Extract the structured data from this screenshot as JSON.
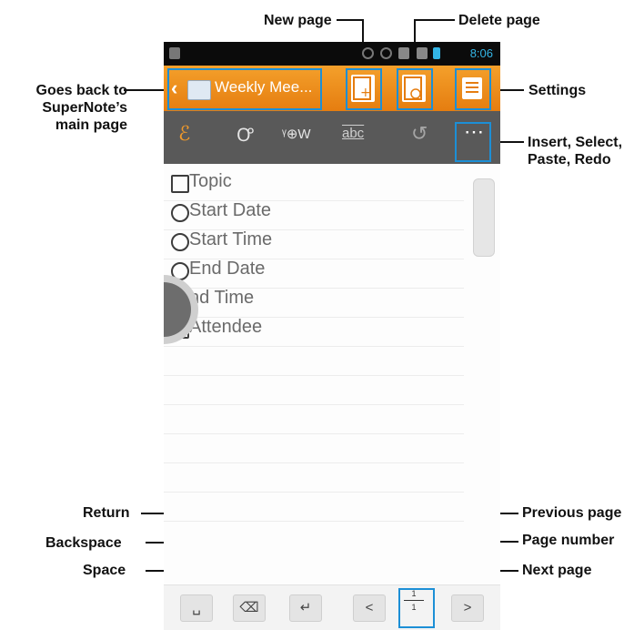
{
  "status_bar": {
    "time": "8:06"
  },
  "app_bar": {
    "back_glyph": "‹",
    "title": "Weekly Mee...",
    "notebook_icon": "notebook-icon"
  },
  "toolbar": {
    "pen_glyph": "ℰ",
    "handwrite_glyph": "Ꝍ",
    "hw_label": "ᵞ⊕W",
    "abc_label": "abc",
    "undo_glyph": "↺",
    "more_glyph": "⋯"
  },
  "template": {
    "items": [
      {
        "label": "Topic",
        "icon": "topic-icon"
      },
      {
        "label": "Start Date",
        "icon": "clock-icon"
      },
      {
        "label": "Start Time",
        "icon": "clock-icon"
      },
      {
        "label": "End Date",
        "icon": "clock-icon"
      },
      {
        "label": "nd Time",
        "icon": "clock-icon"
      },
      {
        "label": "Attendee",
        "icon": "person-icon"
      }
    ]
  },
  "keys": {
    "space": "␣",
    "backspace": "⌫",
    "return": "↵",
    "prev": "<",
    "next": ">",
    "page_top": "1",
    "page_bottom": "1"
  },
  "callouts": {
    "new_page": "New page",
    "delete_page": "Delete page",
    "goes_back_1": "Goes back to",
    "goes_back_2": "SuperNote’s",
    "goes_back_3": "main page",
    "settings": "Settings",
    "insert_1": "Insert, Select,",
    "insert_2": "Paste, Redo",
    "return": "Return",
    "backspace": "Backspace",
    "space": "Space",
    "previous_page": "Previous page",
    "page_number": "Page number",
    "next_page": "Next page"
  },
  "colors": {
    "accent": "#f29a2a",
    "highlight": "#1c8fd6",
    "toolbar": "#595959"
  }
}
